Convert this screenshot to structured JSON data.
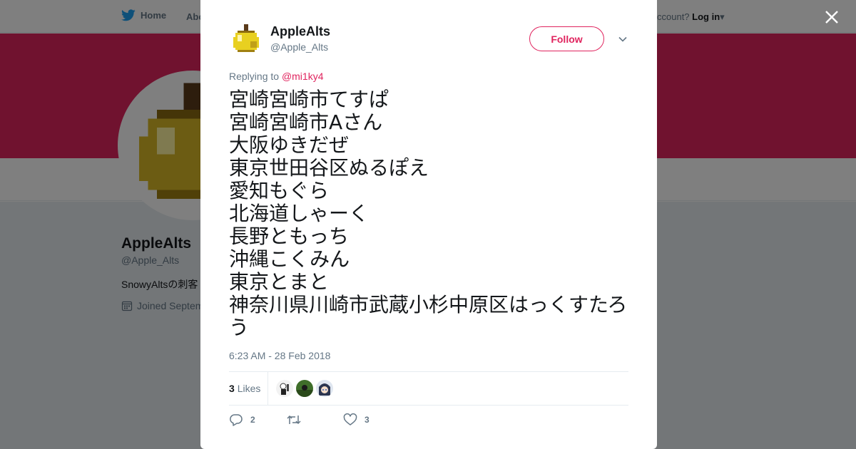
{
  "nav": {
    "home_label": "Home",
    "about_label": "Abo",
    "login_prompt": "ccount?",
    "login_label": "Log in"
  },
  "background_profile": {
    "name": "AppleAlts",
    "handle": "@Apple_Alts",
    "bio": "SnowyAltsの刺客",
    "joined": "Joined Septem"
  },
  "tweet": {
    "author_name": "AppleAlts",
    "author_handle": "@Apple_Alts",
    "follow_label": "Follow",
    "replying_prefix": "Replying to",
    "replying_to": "@mi1ky4",
    "lines": [
      "宮崎宮崎市てすぱ",
      "宮崎宮崎市Aさん",
      "大阪ゆきだぜ",
      "東京世田谷区ぬるぽえ",
      "愛知もぐら",
      "北海道しゃーく",
      "長野ともっち",
      "沖縄こくみん",
      "東京とまと",
      "神奈川県川崎市武蔵小杉中原区はっくすたろう"
    ],
    "timestamp": "6:23 AM - 28 Feb 2018",
    "likes_count": "3",
    "likes_label": "Likes",
    "reply_count": "2",
    "retweet_count": "",
    "like_count": "3"
  },
  "colors": {
    "accent": "#e0245e",
    "twitter_blue": "#1da1f2",
    "muted": "#657786",
    "text": "#14171a"
  },
  "icons": {
    "logo": "twitter-bird-icon",
    "close": "close-icon",
    "caret": "chevron-down-icon",
    "reply": "reply-icon",
    "retweet": "retweet-icon",
    "like": "heart-icon",
    "calendar": "calendar-icon"
  }
}
